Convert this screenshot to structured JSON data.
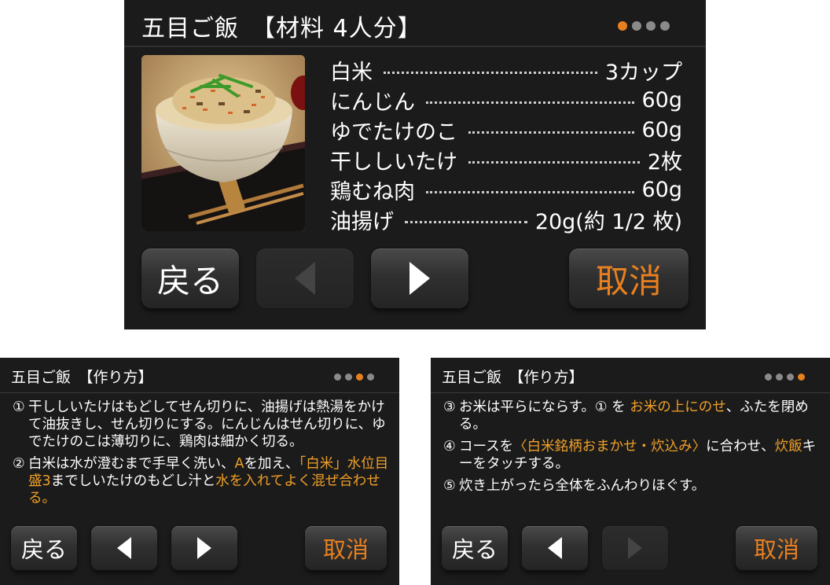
{
  "colors": {
    "panel_bg": "#1b1b1b",
    "accent_orange": "#e8801f",
    "highlight_text": "#f0a028",
    "dot_inactive": "#8a8a8a"
  },
  "screen_ingredients": {
    "title": "五目ご飯　【材料 4人分】",
    "page_indicator": {
      "total": 4,
      "active": 1
    },
    "photo_icon": "gomoku-rice-bowl-photo",
    "ingredients": [
      {
        "name": "白米",
        "amount": "3カップ"
      },
      {
        "name": "にんじん",
        "amount": "60g"
      },
      {
        "name": "ゆでたけのこ",
        "amount": "60g"
      },
      {
        "name": "干ししいたけ",
        "amount": "2枚"
      },
      {
        "name": "鶏むね肉",
        "amount": "60g"
      },
      {
        "name": "油揚げ",
        "amount": "20g(約 1/2 枚)"
      }
    ],
    "buttons": {
      "back": "戻る",
      "prev_icon": "left-triangle-icon",
      "prev_enabled": false,
      "next_icon": "right-triangle-icon",
      "next_enabled": true,
      "cancel": "取消"
    }
  },
  "screen_method_1": {
    "title": "五目ご飯　【作り方】",
    "page_indicator": {
      "total": 4,
      "active": 3
    },
    "steps": [
      {
        "num": "①",
        "parts": [
          {
            "text": "干ししいたけはもどしてせん切りに、油揚げは熱湯をかけて油抜きし、せん切りにする。にんじんはせん切りに、ゆでたけのこは薄切りに、鶏肉は細かく切る。",
            "hl": false
          }
        ]
      },
      {
        "num": "②",
        "parts": [
          {
            "text": "白米は水が澄むまで手早く洗い、",
            "hl": false
          },
          {
            "text": "A",
            "hl": true
          },
          {
            "text": "を加え、",
            "hl": false
          },
          {
            "text": "「白米」水位目盛3",
            "hl": true
          },
          {
            "text": "までしいたけのもどし汁と",
            "hl": false
          },
          {
            "text": "水を入れてよく混ぜ合わせる。",
            "hl": true
          }
        ]
      }
    ],
    "buttons": {
      "back": "戻る",
      "prev_icon": "left-triangle-icon",
      "prev_enabled": true,
      "next_icon": "right-triangle-icon",
      "next_enabled": true,
      "cancel": "取消"
    }
  },
  "screen_method_2": {
    "title": "五目ご飯　【作り方】",
    "page_indicator": {
      "total": 4,
      "active": 4
    },
    "steps": [
      {
        "num": "③",
        "parts": [
          {
            "text": "お米は平らにならす。① を ",
            "hl": false
          },
          {
            "text": "お米の上にのせ",
            "hl": true
          },
          {
            "text": "、ふたを閉める。",
            "hl": false
          }
        ]
      },
      {
        "num": "④",
        "parts": [
          {
            "text": "コースを",
            "hl": false
          },
          {
            "text": "〈白米銘柄おまかせ・炊込み〉",
            "hl": true
          },
          {
            "text": "に合わせ、",
            "hl": false
          },
          {
            "text": "炊飯",
            "hl": true
          },
          {
            "text": "キーをタッチする。",
            "hl": false
          }
        ]
      },
      {
        "num": "⑤",
        "parts": [
          {
            "text": "炊き上がったら全体をふんわりほぐす。",
            "hl": false
          }
        ]
      }
    ],
    "buttons": {
      "back": "戻る",
      "prev_icon": "left-triangle-icon",
      "prev_enabled": true,
      "next_icon": "right-triangle-icon",
      "next_enabled": false,
      "cancel": "取消"
    }
  }
}
